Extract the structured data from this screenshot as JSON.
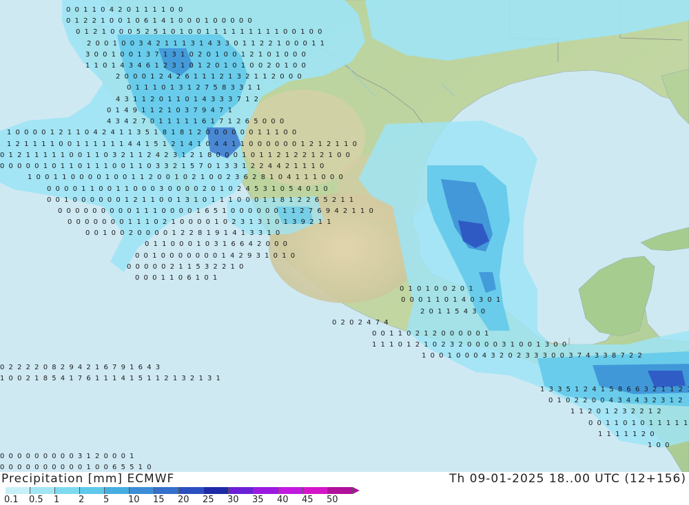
{
  "header": {
    "title_left": "Precipitation [mm] ECMWF",
    "title_right": "Th 09-01-2025 18..00 UTC (12+156)"
  },
  "legend": {
    "labels": [
      "0.1",
      "0.5",
      "1",
      "2",
      "5",
      "10",
      "15",
      "20",
      "25",
      "30",
      "35",
      "40",
      "45",
      "50"
    ],
    "colors": [
      "#c8f0f8",
      "#a2e6f4",
      "#7fdaf0",
      "#5ec9ea",
      "#47aee0",
      "#3b8ed6",
      "#3470cc",
      "#2c4fbf",
      "#1f2aa6",
      "#6c1fd8",
      "#9a1ae0",
      "#c21ae0",
      "#d516c8",
      "#b0109a"
    ]
  },
  "map_colors": {
    "ocean": "#cfe9f3",
    "land_low": "#b9d3a0",
    "land_high": "#dccda6",
    "border": "#8a8a8a"
  },
  "precip_values": [
    {
      "row": 17,
      "text": "0 0 1 1                0 4 2 0 1 1 1 1 0 0"
    },
    {
      "row": 33,
      "text": "0 1 2 2 1 0       0 1 0 6     1 4 1 0     0 0 1 0     0 0 0 0"
    },
    {
      "row": 49,
      "text": "0 1 2 1 0 0     0 5 2 5     1 0 1 0 0 1 1 1 1 1 1 1 1 1 0       0     1 0 0"
    },
    {
      "row": 66,
      "text": "2 0       0 1 0 0 3 4 2 1 1 1 3 1 4 3 3 0 1 1 2 2 1 0            0 0 1 1"
    },
    {
      "row": 82,
      "text": "3       0 0 1 0 0 1 3 7 1 3 1 0 2 0 1 0 0 1 2 1 0 1     0 0 0"
    },
    {
      "row": 98,
      "text": "1       1 0 1 4 3 4 6 1 2 3 1 0 1 2 0 1 0 1 0 0 2 0     1     0     0"
    },
    {
      "row": 114,
      "text": "2 0 0       0 1 2 4 2 6 1 1 1 2 1 3 2 1 1 2 0 0 0"
    },
    {
      "row": 130,
      "text": "0 1 1 1     0 1 3 1 2 7 5 8 3 3 1 1"
    },
    {
      "row": 147,
      "text": "4 3 1 1 2 0     1 1 0 1 4 3 3 3 7 1 2"
    },
    {
      "row": 163,
      "text": "0 1 4 9 1 1 2     1 0 3 7 9 4 7 1"
    },
    {
      "row": 179,
      "text": "4 3 4 2 7 0 1 1     1 1 1 6 1 7 1 2 6 5 0                   0 0"
    },
    {
      "row": 195,
      "text": "1 0     0 0 0 1 2 1 1     0 4 2 4 1 1     3 5 1 8 1 8 1 2 0 0 0 0     0           0       1 1 1 0 0"
    },
    {
      "row": 212,
      "text": "1 2 1 1 1 1 0 0 1 1 1 1 1 1 4 4 1     5 1 2 1 4 1 0 4 4 1     1       0 0 0 0 0 0 1 2 1 2 1 1 0"
    },
    {
      "row": 228,
      "text": "0 1 2 1 1 1 1 1 0 0 1 1 0 3 2 1 1     2 4 2 3 1 2 1 8 0 0       0 1 0 1 1     2 1 2 2 1 2 1 0 0"
    },
    {
      "row": 244,
      "text": "0 0 0 0 0 1 0 1 1 0 1 1 1 0     0 1 1 0 3 3 2 1 5 7       0 1 3 3 1 2 2 4 4 2 1 1 1 0"
    },
    {
      "row": 260,
      "text": "1 0     0 1 1 0 0 0 0 1 0 0     1 1     2 0 0 1 0 2     1     0 0 2 3 6 2 8 1 0 4 1 1 1 0 0 0"
    },
    {
      "row": 277,
      "text": "0 0 0 0 1 1 0 0 1 1 0     0 0 3     0 0 0 0 2       0 1   0     2 4 5 3 1 0 5 4 0 1 0"
    },
    {
      "row": 293,
      "text": "0 0 1 0 0     0 0 0 0     1 2 1     1     0     0 1 3 1     0     1 1 1 0     0 0 1 1 8 1 2 2 6 5 2 1 1"
    },
    {
      "row": 309,
      "text": "0 0 0 0 0 0 0 0 0     1 1 1 0 0 0     0 1 6 5 1     0     0 0 0 0 0 1 1 2 7 6 9 4 2 1 1 0"
    },
    {
      "row": 325,
      "text": "0 0 0     0 0 0       0 1 1 1     0 2 1 0     0 0 0     1     0 2 3 1 3 1 0 1 3 9 2 1 1"
    },
    {
      "row": 341,
      "text": "0         0 1 0 0       2 0 0 0     0 1 2 2 8 1 9 1 4 1 3 3 1 0"
    },
    {
      "row": 357,
      "text": "0 1 1     0     0           0     1 0 3 1 6 6 4 2 0 0 0"
    },
    {
      "row": 374,
      "text": "0 0 1 0 0 0     0           0     0 0 1 4 2 9 3 1 0 1 0"
    },
    {
      "row": 390,
      "text": "0 0 0           0     0 2 1 1 5 3 2 2 1 0"
    },
    {
      "row": 406,
      "text": "0           0     0     1 1 0 6 1 0 1"
    },
    {
      "row": 422,
      "text": "0 1 0 1     0 0 2 0 1"
    },
    {
      "row": 438,
      "text": "0 0     0 1 1 0 1 4     0 3 0 1"
    },
    {
      "row": 455,
      "text": "2 0 1 1     5 4 3 0"
    },
    {
      "row": 471,
      "text": "0         2 0 2 4 7 4"
    },
    {
      "row": 487,
      "text": "0     0     1 1 0 2 1 2 0     0 0 0 0 1"
    },
    {
      "row": 503,
      "text": "1 1 1 0     1 2 1 0 2 3 2 0 0 0     0 3 1 0     0 1 3 0 0"
    },
    {
      "row": 519,
      "text": "1 0 0 1     0 0 0 4 3 2 0 2 3 3 3 0     0 3 7 4 3 3 8 7 2 2"
    },
    {
      "row": 536,
      "text": "0     2 2 2 2 0 8 2 9 4 2 1 6 7 9 1 6 4 3"
    },
    {
      "row": 552,
      "text": "1 0     0 2 1 8 5 4 1 7 6 1 1 1 4 1 5 1 1 2 1 3 2 1 3 1"
    },
    {
      "row": 568,
      "text": "1 3 3 5 1 2 4 1 5 8 6 6 3 2 1 1 2 1 0 1 3 5"
    },
    {
      "row": 584,
      "text": "0     1 0 2 2 0 0 4 3 4 4 3 2 3 1 2"
    },
    {
      "row": 600,
      "text": "1     1   2 0 1 2 3 2 2 1 2"
    },
    {
      "row": 617,
      "text": "0 0 1 1 0 1 0 1 1 1 1 1"
    },
    {
      "row": 633,
      "text": "1 1 1     1     1 2 0"
    },
    {
      "row": 649,
      "text": "1     0 0"
    },
    {
      "row": 665,
      "text": "0 0 0 0 0 0 0     0           0 3 1 2 0 0       0 1"
    },
    {
      "row": 681,
      "text": "0 0 0 0 0     0 0 0     0 0 1 0     0 6 5 5 1 0"
    }
  ]
}
